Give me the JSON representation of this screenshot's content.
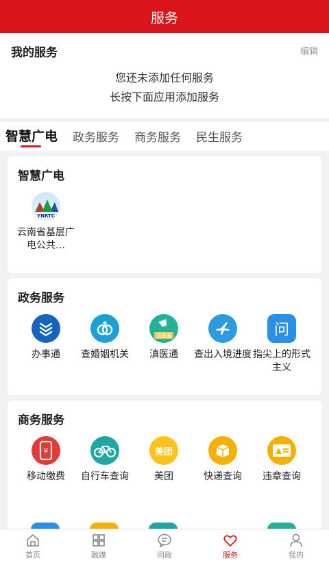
{
  "header": {
    "title": "服务"
  },
  "my_services": {
    "title": "我的服务",
    "edit_label": "编辑",
    "empty_line1": "您还未添加任何服务",
    "empty_line2": "长按下面应用添加服务"
  },
  "tabs": [
    {
      "label": "智慧广电",
      "active": true
    },
    {
      "label": "政务服务"
    },
    {
      "label": "商务服务"
    },
    {
      "label": "民生服务"
    }
  ],
  "sections": [
    {
      "title": "智慧广电",
      "items": [
        {
          "label": "云南省基层广电公共…",
          "icon": "yunnan-logo-icon",
          "icon_text": "YNRTC"
        }
      ]
    },
    {
      "title": "政务服务",
      "items": [
        {
          "label": "办事通",
          "icon": "banshitong-icon"
        },
        {
          "label": "查婚姻机关",
          "icon": "rings-icon"
        },
        {
          "label": "滇医通",
          "icon": "medical-icon",
          "icon_text": "滇医通"
        },
        {
          "label": "查出入境进度",
          "icon": "airplane-icon"
        },
        {
          "label": "指尖上的形式主义",
          "icon": "question-chat-icon",
          "icon_text": "问"
        }
      ]
    },
    {
      "title": "商务服务",
      "items": [
        {
          "label": "移动缴费",
          "icon": "phone-pay-icon",
          "icon_text": "¥"
        },
        {
          "label": "自行车查询",
          "icon": "bicycle-icon"
        },
        {
          "label": "美团",
          "icon": "meituan-icon",
          "icon_text": "美团"
        },
        {
          "label": "快递查询",
          "icon": "package-icon"
        },
        {
          "label": "违章查询",
          "icon": "warning-card-icon"
        }
      ]
    }
  ],
  "bottom_nav": [
    {
      "label": "首页",
      "icon": "home-icon"
    },
    {
      "label": "融媒",
      "icon": "grid-icon"
    },
    {
      "label": "问政",
      "icon": "chat-icon"
    },
    {
      "label": "服务",
      "icon": "heart-icon",
      "active": true
    },
    {
      "label": "我的",
      "icon": "user-icon"
    }
  ],
  "colors": {
    "brand": "#d9151b"
  }
}
